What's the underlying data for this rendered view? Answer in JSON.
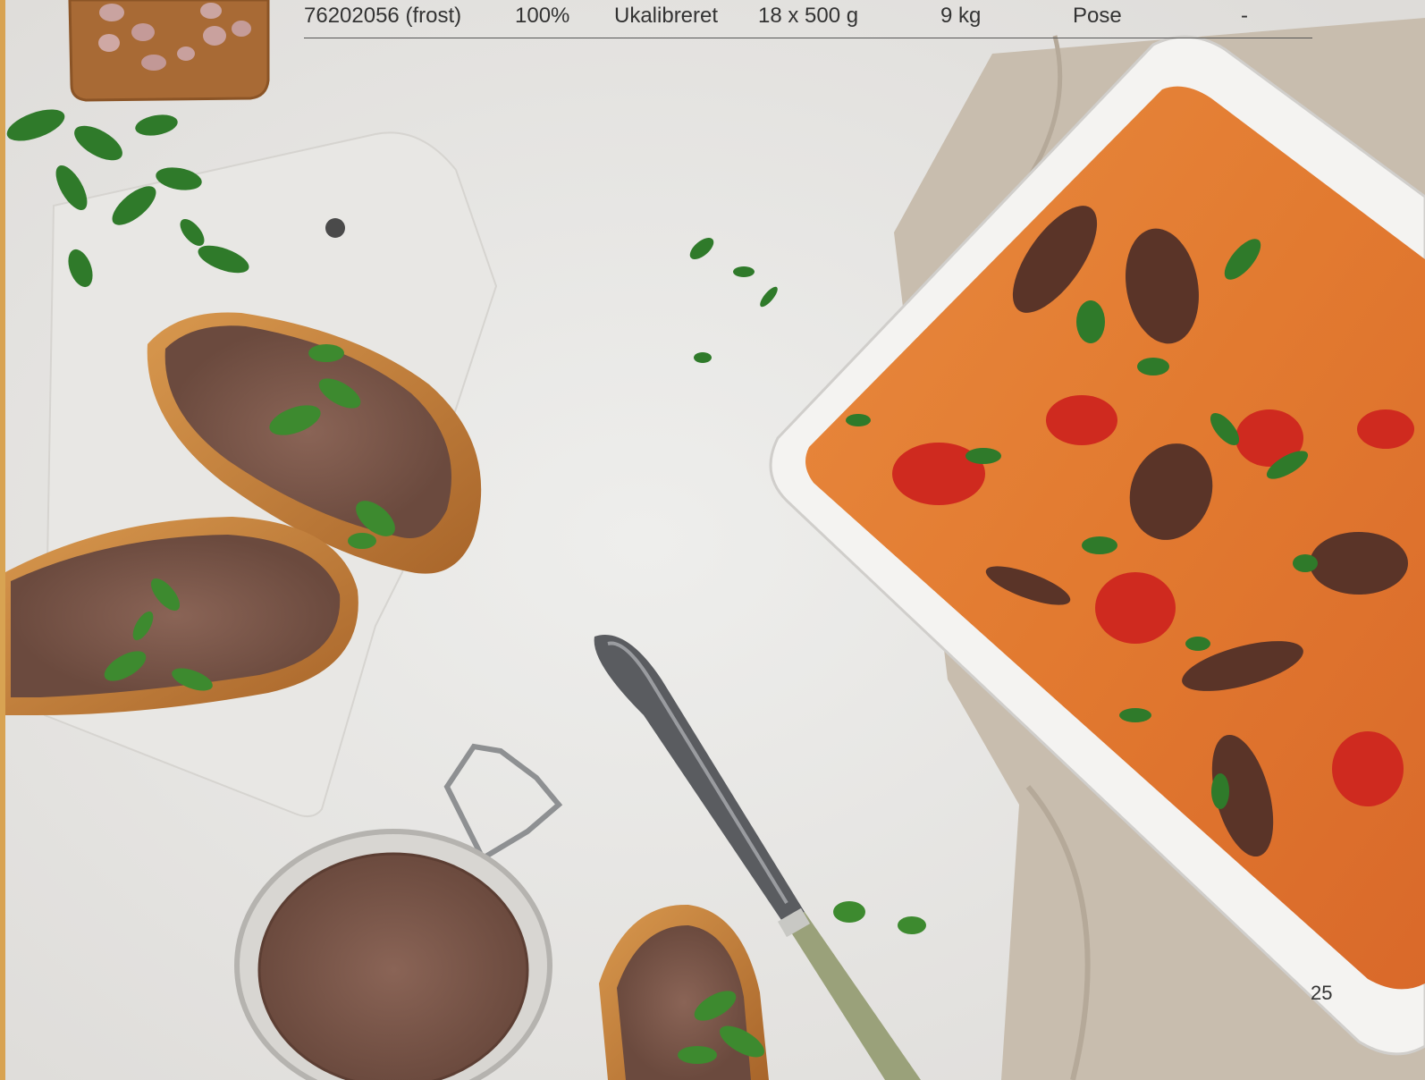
{
  "product_row": {
    "item_number": "76202056 (frost)",
    "share": "100%",
    "calibration": "Ukalibreret",
    "pack_size": "18 x 500 g",
    "case_weight": "9 kg",
    "packaging": "Pose",
    "extra": "-"
  },
  "page": {
    "number": "25"
  },
  "photo": {
    "thumbnail": "liver-pieces-on-board-image",
    "main": "liver-pate-toast-and-liver-stew-photo"
  }
}
